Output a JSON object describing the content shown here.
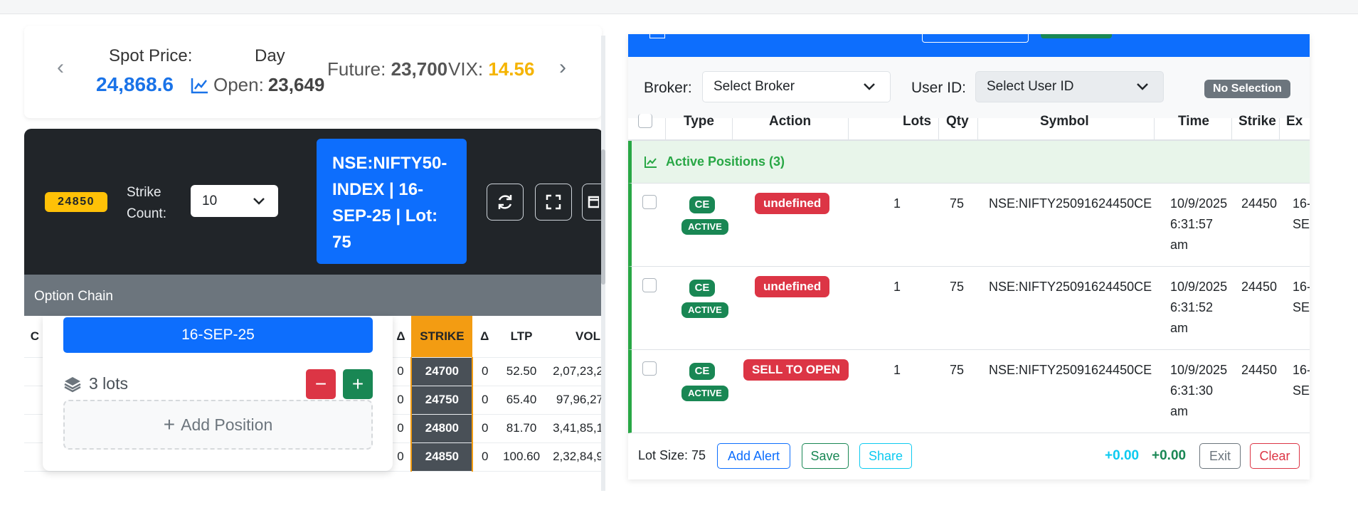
{
  "spot": {
    "spot_label": "Spot Price:",
    "spot_value": "24,868.6",
    "day_label": "Day",
    "open_label": "Open:",
    "open_value": "23,649",
    "future_label": "Future:",
    "future_value": "23,700",
    "vix_label": "VIX:",
    "vix_value": "14.56"
  },
  "toolbar": {
    "atm_strike": "24850",
    "strike_count_label": "Strike Count:",
    "strike_count_value": "10",
    "index_info": "NSE:NIFTY50-INDEX | 16-SEP-25 | Lot: 75"
  },
  "option_chain": {
    "title": "Option Chain",
    "headers": [
      "C",
      "Δ",
      "STRIKE",
      "Δ",
      "LTP",
      "VOL"
    ],
    "rows": [
      {
        "strike": "24700",
        "ce_delta": "0",
        "pe_delta": "0",
        "ltp": "52.50",
        "vol": "2,07,23,2"
      },
      {
        "strike": "24750",
        "ce_delta": "0",
        "pe_delta": "0",
        "ltp": "65.40",
        "vol": "97,96,27"
      },
      {
        "strike": "24800",
        "ce_delta": "0",
        "pe_delta": "0",
        "ltp": "81.70",
        "vol": "3,41,85,1"
      },
      {
        "strike": "24850",
        "ce_delta": "0",
        "pe_delta": "0",
        "ltp": "100.60",
        "vol": "2,32,84,9"
      }
    ]
  },
  "position_builder": {
    "expiry": "16-SEP-25",
    "lots_text": "3 lots",
    "minus": "−",
    "plus": "+",
    "add_position": "Add Position"
  },
  "right": {
    "broker_label": "Broker:",
    "broker_select": "Select Broker",
    "user_label": "User ID:",
    "user_select": "Select User ID",
    "no_selection": "No Selection",
    "columns": [
      "Type",
      "Action",
      "Lots",
      "Qty",
      "Symbol",
      "Time",
      "Strike",
      "Ex"
    ],
    "active_group": "Active Positions (3)",
    "positions": [
      {
        "type": "CE",
        "status": "ACTIVE",
        "action": "undefined",
        "lots": "1",
        "qty": "75",
        "symbol": "NSE:NIFTY25091624450CE",
        "time_date": "10/9/2025",
        "time_clock": "6:31:57",
        "time_ampm": "am",
        "strike": "24450",
        "expiry_a": "16-",
        "expiry_b": "SEP"
      },
      {
        "type": "CE",
        "status": "ACTIVE",
        "action": "undefined",
        "lots": "1",
        "qty": "75",
        "symbol": "NSE:NIFTY25091624450CE",
        "time_date": "10/9/2025",
        "time_clock": "6:31:52",
        "time_ampm": "am",
        "strike": "24450",
        "expiry_a": "16-",
        "expiry_b": "SEP"
      },
      {
        "type": "CE",
        "status": "ACTIVE",
        "action": "SELL TO OPEN",
        "lots": "1",
        "qty": "75",
        "symbol": "NSE:NIFTY25091624450CE",
        "time_date": "10/9/2025",
        "time_clock": "6:31:30",
        "time_ampm": "am",
        "strike": "24450",
        "expiry_a": "16-",
        "expiry_b": "SEP"
      }
    ],
    "footer": {
      "lot_size": "Lot Size: 75",
      "add_alert": "Add Alert",
      "save": "Save",
      "share": "Share",
      "pnl_1": "+0.00",
      "pnl_2": "+0.00",
      "exit": "Exit",
      "clear": "Clear"
    }
  }
}
